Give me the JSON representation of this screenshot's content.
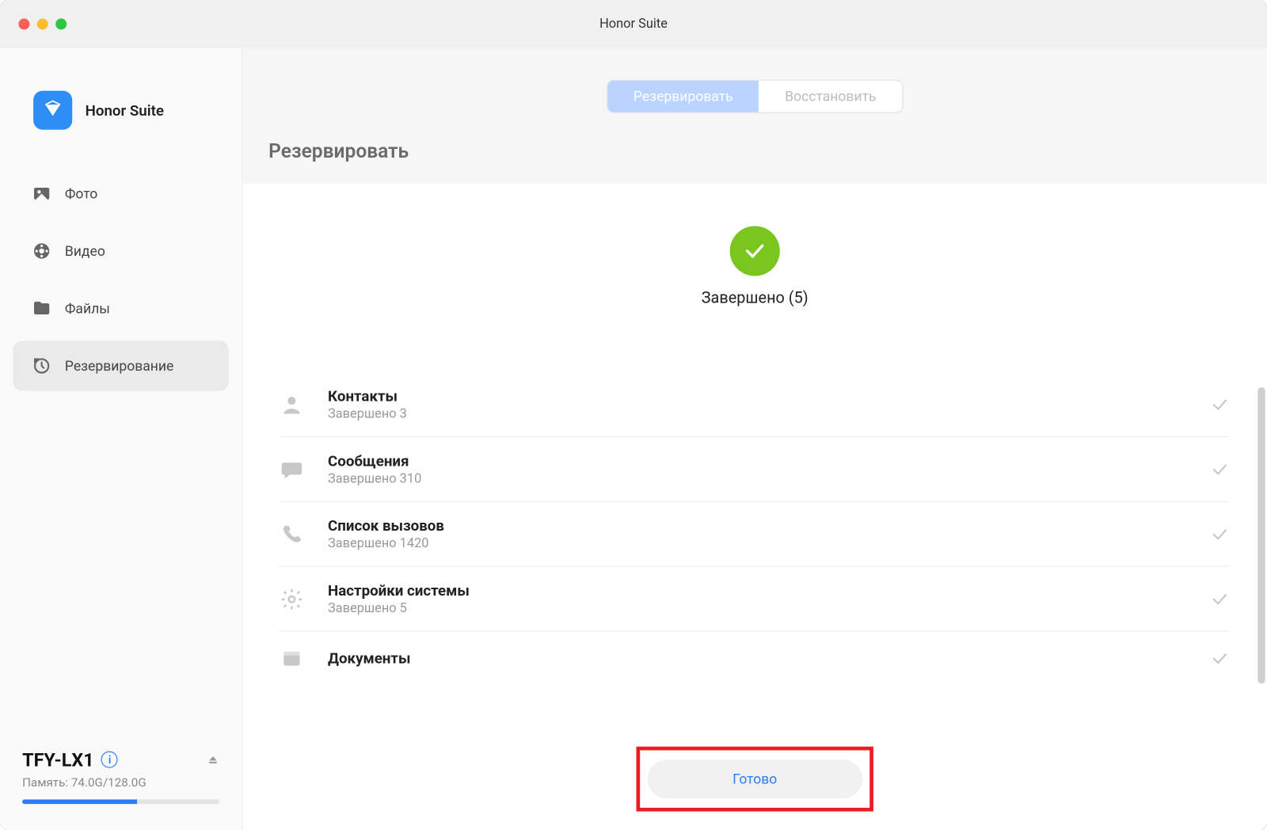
{
  "window": {
    "title": "Honor Suite"
  },
  "brand": {
    "label": "Honor Suite"
  },
  "sidebar": {
    "items": [
      {
        "label": "Фото"
      },
      {
        "label": "Видео"
      },
      {
        "label": "Файлы"
      },
      {
        "label": "Резервирование"
      }
    ]
  },
  "device": {
    "name": "TFY-LX1",
    "storage_prefix": "Память:",
    "storage_used": "74.0G",
    "storage_total": "128.0G",
    "storage_percent": 58
  },
  "tabs": {
    "backup": "Резервировать",
    "restore": "Восстановить"
  },
  "section": {
    "title": "Резервировать"
  },
  "status": {
    "label": "Завершено",
    "count": 5,
    "text": "Завершено (5)"
  },
  "results": [
    {
      "title": "Контакты",
      "sub": "Завершено 3",
      "icon": "person"
    },
    {
      "title": "Сообщения",
      "sub": "Завершено 310",
      "icon": "chat"
    },
    {
      "title": "Список  вызовов",
      "sub": "Завершено 1420",
      "icon": "phone"
    },
    {
      "title": "Настройки  системы",
      "sub": "Завершено 5",
      "icon": "gear"
    },
    {
      "title": "Документы",
      "sub": "",
      "icon": "file"
    }
  ],
  "done": {
    "label": "Готово"
  }
}
